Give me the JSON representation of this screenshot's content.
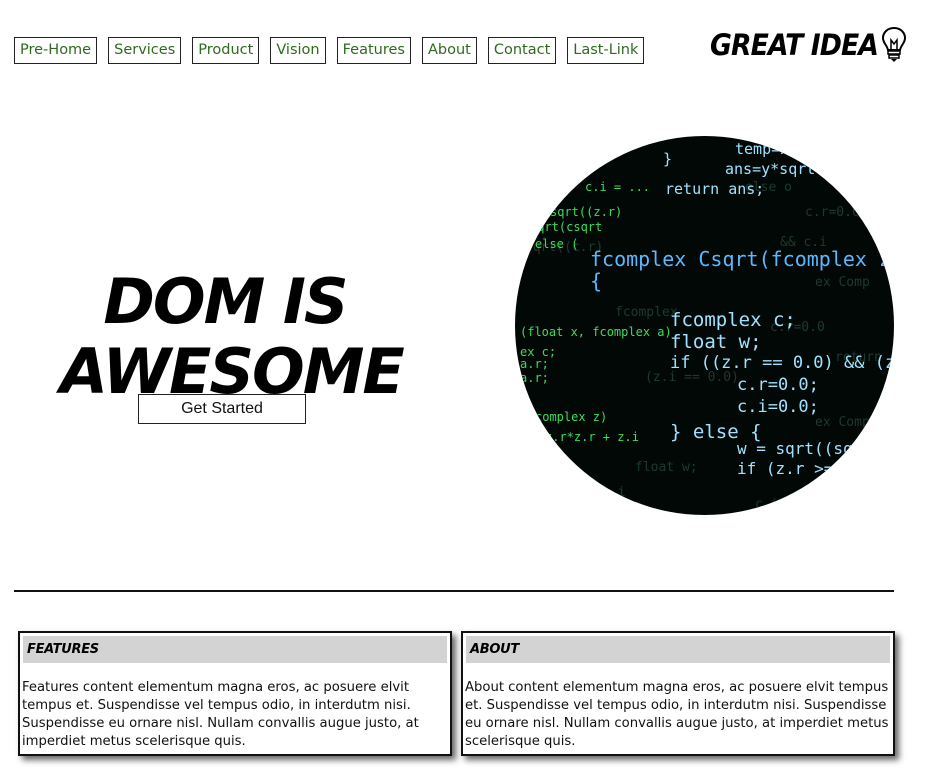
{
  "nav": {
    "items": [
      {
        "label": "Pre-Home"
      },
      {
        "label": "Services"
      },
      {
        "label": "Product"
      },
      {
        "label": "Vision"
      },
      {
        "label": "Features"
      },
      {
        "label": "About"
      },
      {
        "label": "Contact"
      },
      {
        "label": "Last-Link"
      }
    ]
  },
  "logo": {
    "text": "GREAT IDEA",
    "icon": "lightbulb-icon"
  },
  "hero": {
    "title": "DOM IS AWESOME",
    "button_label": "Get Started",
    "image": "code-screen-image"
  },
  "cards": [
    {
      "title": "FEATURES",
      "body": "Features content elementum magna eros, ac posuere elvit tempus et. Suspendisse vel tempus odio, in interdutm nisi. Suspendisse eu ornare nisl. Nullam convallis augue justo, at imperdiet metus scelerisque quis."
    },
    {
      "title": "ABOUT",
      "body": "About content elementum magna eros, ac posuere elvit tempus et. Suspendisse vel tempus odio, in interdutm nisi. Suspendisse eu ornare nisl. Nullam convallis augue justo, at imperdiet metus scelerisque quis."
    }
  ],
  "colors": {
    "nav_link": "#2e6b1f",
    "card_header": "#d3d3d3",
    "code_green": "#3ddc5a",
    "code_blue": "#5ab8ff"
  }
}
